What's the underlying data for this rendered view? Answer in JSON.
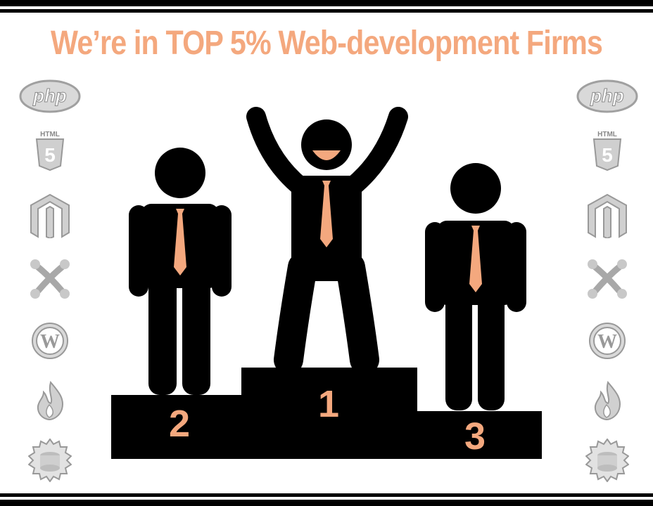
{
  "banner": {
    "title": "We’re in TOP 5% Web-development Firms"
  },
  "podium": {
    "first": "1",
    "second": "2",
    "third": "3"
  },
  "icons": {
    "html5_label": "HTML",
    "php_label": "php",
    "list": [
      "php-icon",
      "html5-icon",
      "magento-icon",
      "joomla-icon",
      "wordpress-icon",
      "codeigniter-icon",
      "cakephp-icon"
    ]
  },
  "colors": {
    "accent": "#f4a87e",
    "ink": "#000000",
    "icon_gray": "#b8b8b8"
  }
}
